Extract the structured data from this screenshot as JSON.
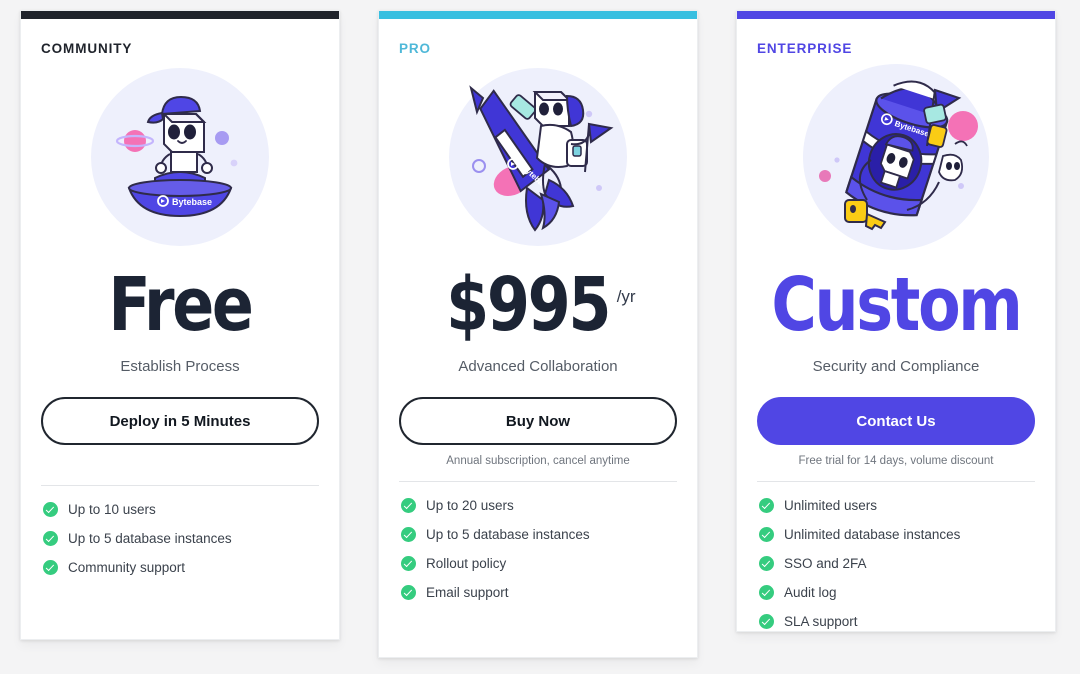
{
  "theme": {
    "page_background": "#f4f4f5",
    "card_background": "#ffffff",
    "brand_purple": "#5046e4",
    "pro_cyan": "#38bfe0",
    "community_dark": "#1f232b",
    "check_green": "#35cc7f",
    "price_dark": "#1c2434"
  },
  "plans": [
    {
      "id": "community",
      "name": "COMMUNITY",
      "name_color": "#1f232b",
      "top_bar_color": "#1f232b",
      "illustration": "bytebase-mascot-ufo-illustration",
      "price": "Free",
      "price_suffix": "",
      "price_color": "#1c2434",
      "tagline": "Establish Process",
      "cta_label": "Deploy in 5 Minutes",
      "cta_style": "outline",
      "cta_note": "",
      "features": [
        "Up to 10 users",
        "Up to 5 database instances",
        "Community support"
      ]
    },
    {
      "id": "pro",
      "name": "PRO",
      "name_color": "#4fb8d8",
      "top_bar_color": "#38bfe0",
      "illustration": "bytebase-mascot-rocket-illustration",
      "price": "$995",
      "price_suffix": "/yr",
      "price_color": "#1c2434",
      "tagline": "Advanced Collaboration",
      "cta_label": "Buy Now",
      "cta_style": "outline",
      "cta_note": "Annual subscription, cancel anytime",
      "features": [
        "Up to 20 users",
        "Up to 5 database instances",
        "Rollout policy",
        "Email support"
      ]
    },
    {
      "id": "enterprise",
      "name": "ENTERPRISE",
      "name_color": "#5046e4",
      "top_bar_color": "#5046e4",
      "illustration": "bytebase-mascot-capsule-illustration",
      "price": "Custom",
      "price_suffix": "",
      "price_color": "#5046e4",
      "tagline": "Security and Compliance",
      "cta_label": "Contact Us",
      "cta_style": "filled",
      "cta_note": "Free trial for 14 days, volume discount",
      "features": [
        "Unlimited users",
        "Unlimited database instances",
        "SSO and 2FA",
        "Audit log",
        "SLA support"
      ]
    }
  ]
}
